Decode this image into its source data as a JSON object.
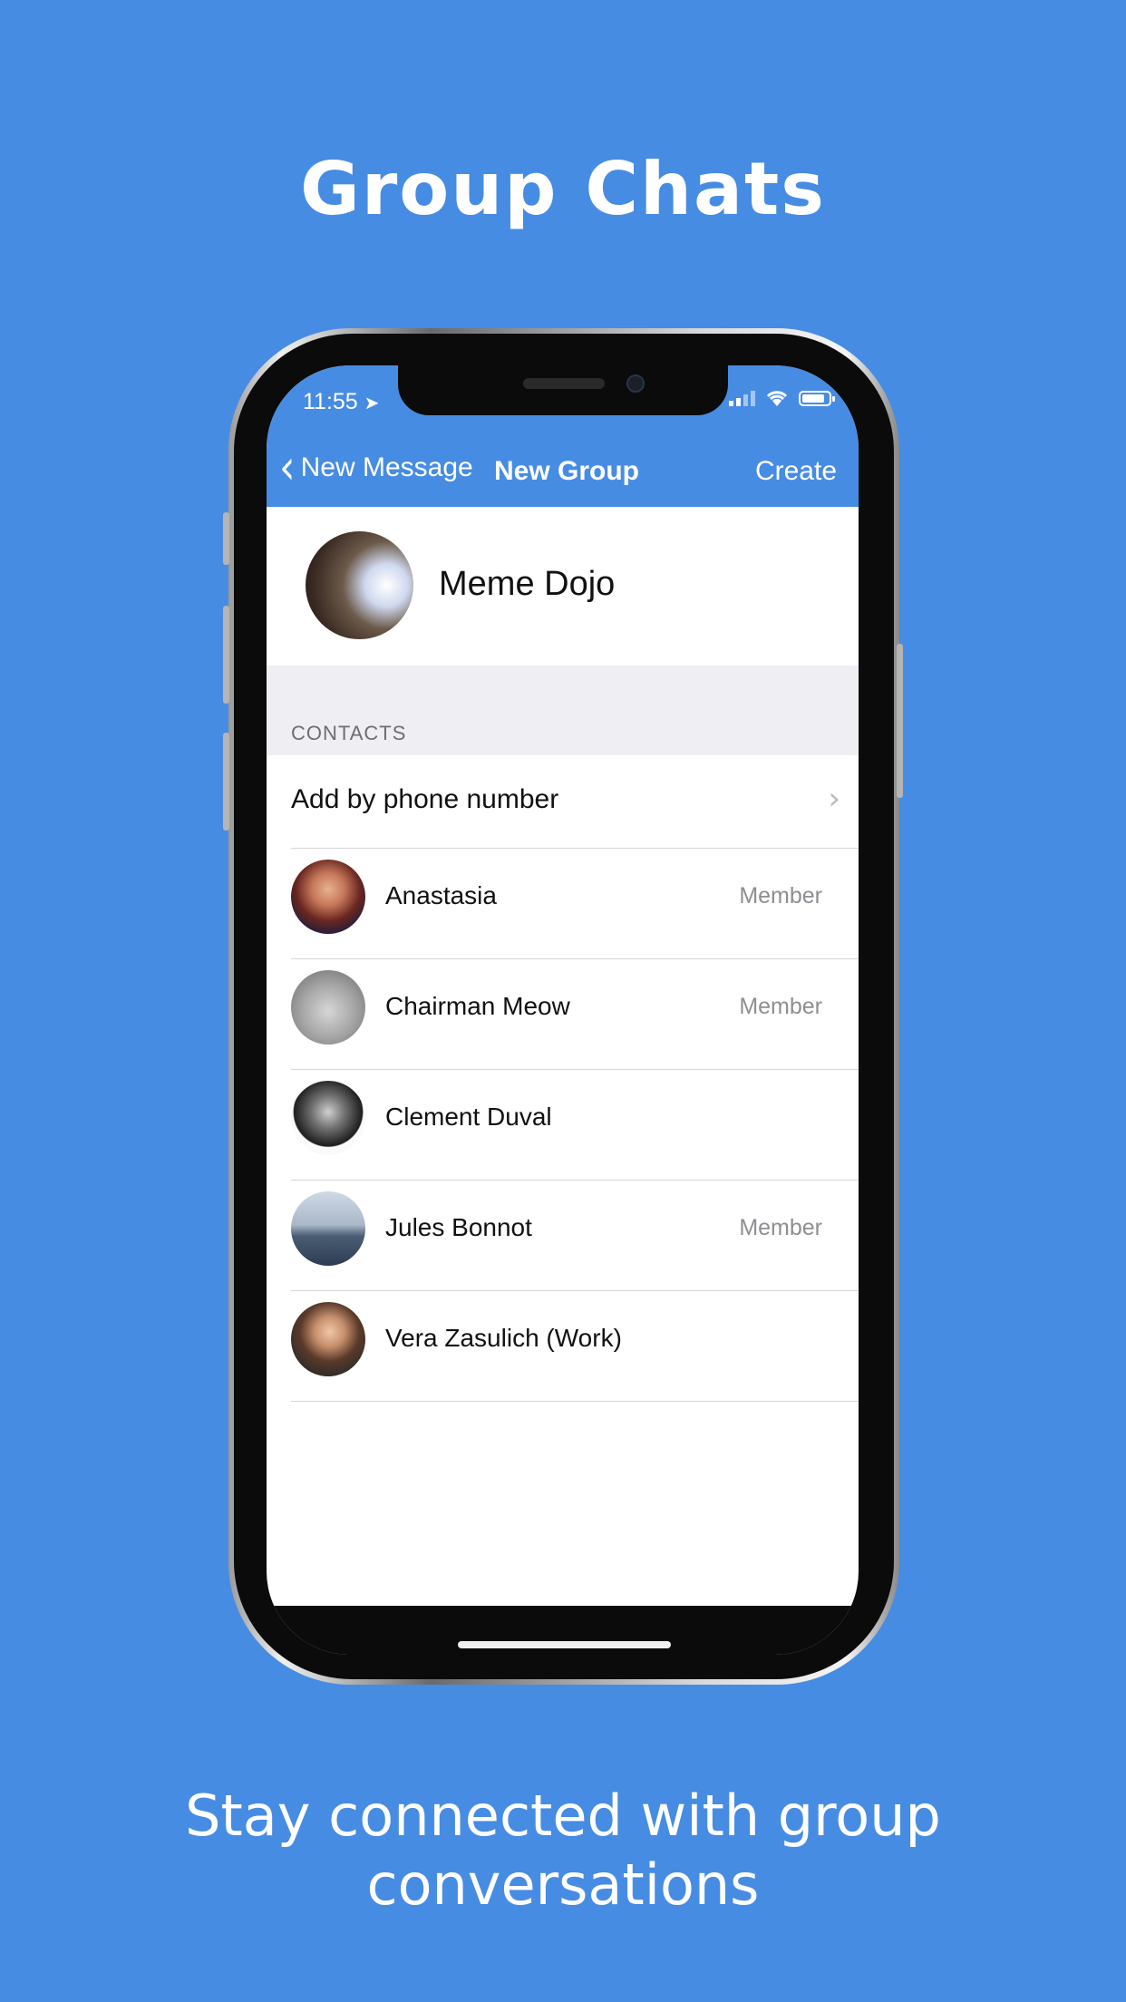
{
  "headline": "Group Chats",
  "tagline": "Stay connected with group conversations",
  "status_bar": {
    "time": "11:55",
    "location_arrow": "location-arrow-icon"
  },
  "nav": {
    "back_label": "New Message",
    "title": "New Group",
    "action": "Create"
  },
  "group": {
    "name": "Meme Dojo"
  },
  "contacts_section": {
    "header": "CONTACTS",
    "add_label": "Add by phone number",
    "items": [
      {
        "name": "Anastasia",
        "badge": "Member"
      },
      {
        "name": "Chairman Meow",
        "badge": "Member"
      },
      {
        "name": "Clement Duval",
        "badge": ""
      },
      {
        "name": "Jules Bonnot",
        "badge": "Member"
      },
      {
        "name": "Vera Zasulich (Work)",
        "badge": ""
      }
    ]
  },
  "colors": {
    "brand": "#478CE3",
    "section_bg": "#EEEEF3",
    "badge_text": "#8e8e93"
  }
}
